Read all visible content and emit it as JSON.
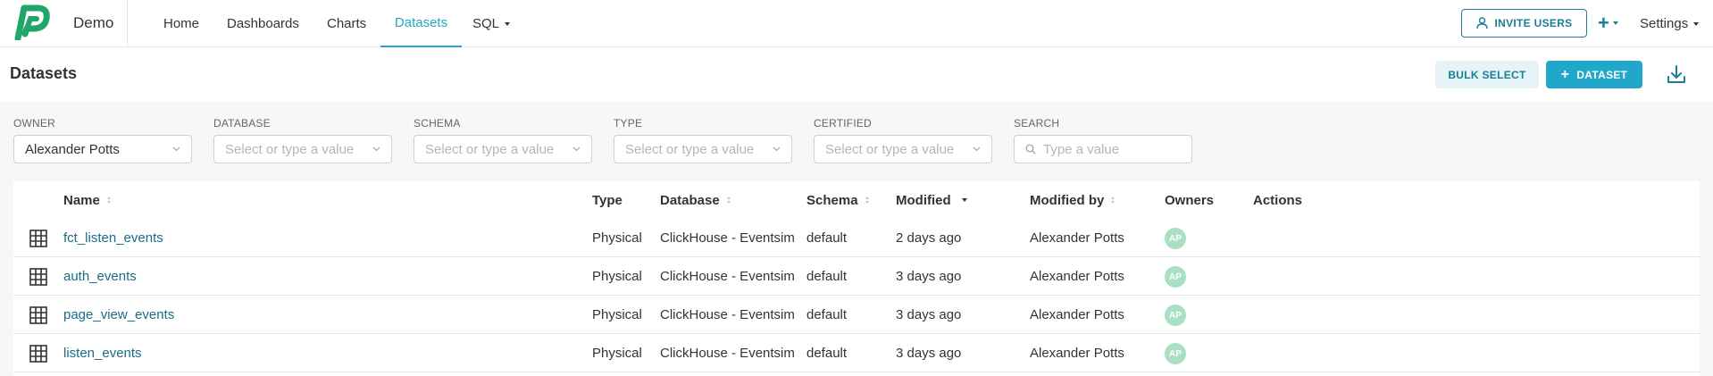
{
  "app": {
    "brand": "Demo",
    "accent": "#20a7c9",
    "logo_color": "#20a66a"
  },
  "nav": {
    "items": [
      {
        "label": "Home"
      },
      {
        "label": "Dashboards"
      },
      {
        "label": "Charts"
      },
      {
        "label": "Datasets",
        "active": true
      },
      {
        "label": "SQL"
      }
    ],
    "invite_label": "INVITE USERS",
    "plus_label": "+",
    "settings_label": "Settings"
  },
  "header": {
    "title": "Datasets",
    "bulk_select_label": "BULK SELECT",
    "add_dataset_label": "DATASET",
    "add_dataset_icon": "+",
    "download_icon": "download-icon"
  },
  "filters": {
    "owner": {
      "label": "OWNER",
      "value": "Alexander Potts"
    },
    "database": {
      "label": "DATABASE",
      "placeholder": "Select or type a value"
    },
    "schema": {
      "label": "SCHEMA",
      "placeholder": "Select or type a value"
    },
    "type": {
      "label": "TYPE",
      "placeholder": "Select or type a value"
    },
    "certified": {
      "label": "CERTIFIED",
      "placeholder": "Select or type a value"
    },
    "search": {
      "label": "SEARCH",
      "placeholder": "Type a value"
    }
  },
  "table": {
    "columns": [
      "Name",
      "Type",
      "Database",
      "Schema",
      "Modified",
      "Modified by",
      "Owners",
      "Actions"
    ],
    "sorted_column": "Modified",
    "sort_direction": "desc",
    "rows": [
      {
        "name": "fct_listen_events",
        "type": "Physical",
        "database": "ClickHouse - Eventsim",
        "schema": "default",
        "modified": "2 days ago",
        "modified_by": "Alexander Potts",
        "owner_initials": "AP"
      },
      {
        "name": "auth_events",
        "type": "Physical",
        "database": "ClickHouse - Eventsim",
        "schema": "default",
        "modified": "3 days ago",
        "modified_by": "Alexander Potts",
        "owner_initials": "AP"
      },
      {
        "name": "page_view_events",
        "type": "Physical",
        "database": "ClickHouse - Eventsim",
        "schema": "default",
        "modified": "3 days ago",
        "modified_by": "Alexander Potts",
        "owner_initials": "AP"
      },
      {
        "name": "listen_events",
        "type": "Physical",
        "database": "ClickHouse - Eventsim",
        "schema": "default",
        "modified": "3 days ago",
        "modified_by": "Alexander Potts",
        "owner_initials": "AP"
      }
    ]
  }
}
